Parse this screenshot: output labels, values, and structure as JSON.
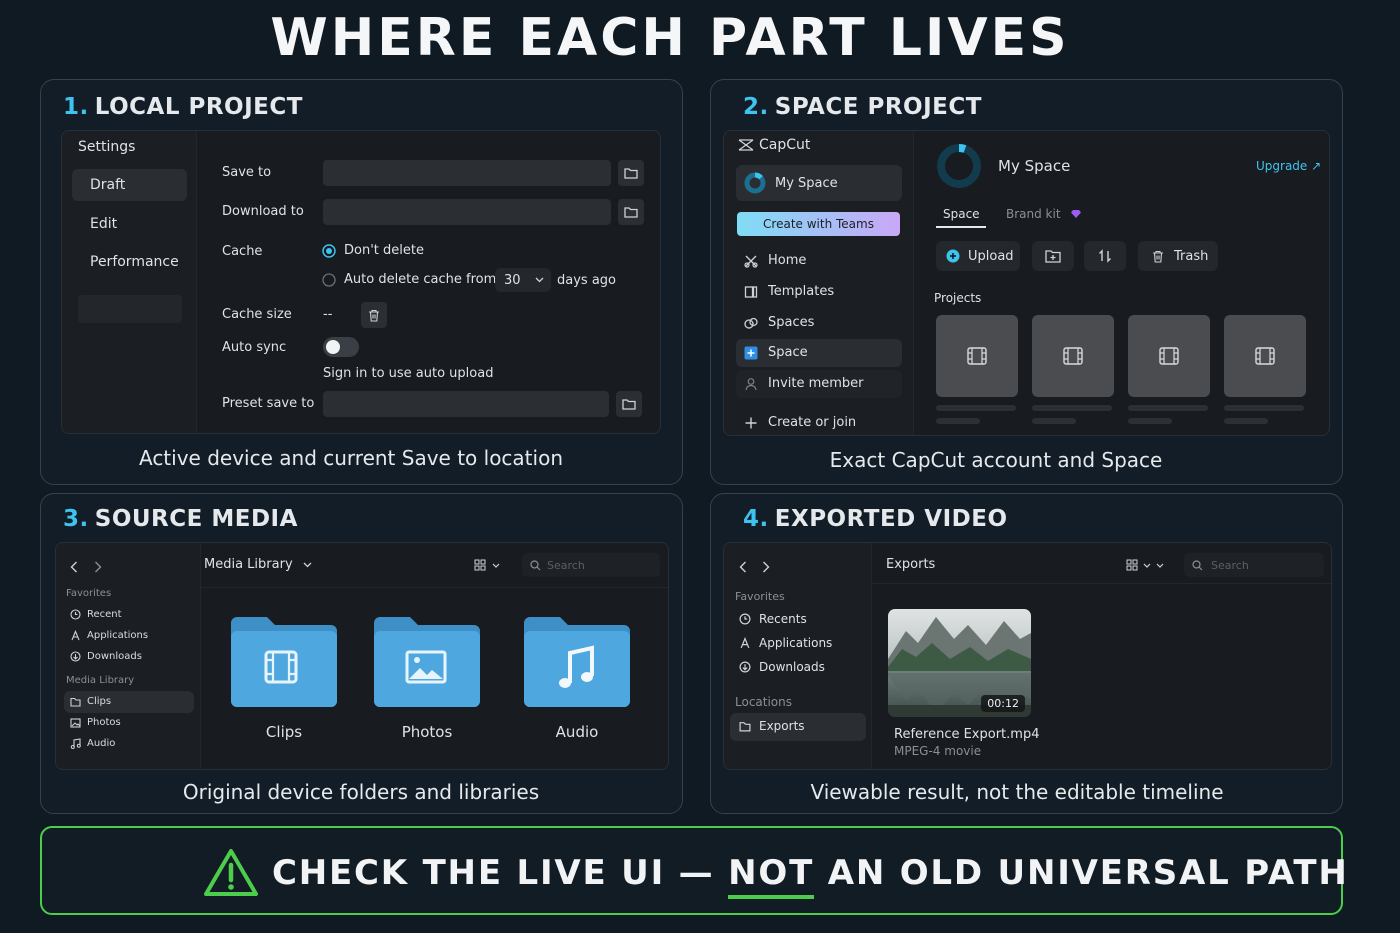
{
  "title": "WHERE EACH PART LIVES",
  "sections": {
    "local": {
      "num": "1.",
      "heading": "LOCAL PROJECT",
      "settings_title": "Settings",
      "tabs": [
        "Draft",
        "Edit",
        "Performance"
      ],
      "save_to": "Save to",
      "download_to": "Download to",
      "cache": "Cache",
      "dont_delete": "Don't delete",
      "auto_delete": "Auto delete cache from",
      "days_value": "30",
      "days_ago": "days ago",
      "cache_size": "Cache size",
      "cache_size_value": "--",
      "auto_sync": "Auto sync",
      "sign_in": "Sign in to use auto upload",
      "preset_save_to": "Preset save to",
      "caption": "Active device and current Save to location"
    },
    "space": {
      "num": "2.",
      "heading": "SPACE PROJECT",
      "app_name": "CapCut",
      "my_space": "My Space",
      "create_with_teams": "Create with Teams",
      "nav": [
        "Home",
        "Templates",
        "Spaces",
        "Space",
        "Invite member",
        "Create or join"
      ],
      "header_title": "My Space",
      "upgrade": "Upgrade ↗",
      "tab_space": "Space",
      "tab_brand": "Brand kit",
      "upload": "Upload",
      "trash": "Trash",
      "projects": "Projects",
      "caption": "Exact CapCut account and Space"
    },
    "media": {
      "num": "3.",
      "heading": "SOURCE MEDIA",
      "location": "Media Library",
      "search": "Search",
      "favorites": "Favorites",
      "fav_items": [
        "Recent",
        "Applications",
        "Downloads"
      ],
      "library": "Media Library",
      "lib_items": [
        "Clips",
        "Photos",
        "Audio"
      ],
      "folders": [
        "Clips",
        "Photos",
        "Audio"
      ],
      "caption": "Original device folders and libraries"
    },
    "export": {
      "num": "4.",
      "heading": "EXPORTED VIDEO",
      "location": "Exports",
      "search": "Search",
      "favorites": "Favorites",
      "fav_items": [
        "Recents",
        "Applications",
        "Downloads"
      ],
      "locations": "Locations",
      "loc_items": [
        "Exports"
      ],
      "duration": "00:12",
      "file_name": "Reference Export.mp4",
      "file_type": "MPEG-4 movie",
      "caption": "Viewable result, not the editable timeline"
    }
  },
  "banner": {
    "pre": "CHECK THE LIVE UI — ",
    "emph": "NOT",
    "post": " AN OLD UNIVERSAL PATH"
  },
  "colors": {
    "accent": "#3ec3ee",
    "warning": "#4ccd4c",
    "background": "#101a23",
    "teams_gradient": [
      "#7fdcf5",
      "#c9a7f7"
    ]
  }
}
